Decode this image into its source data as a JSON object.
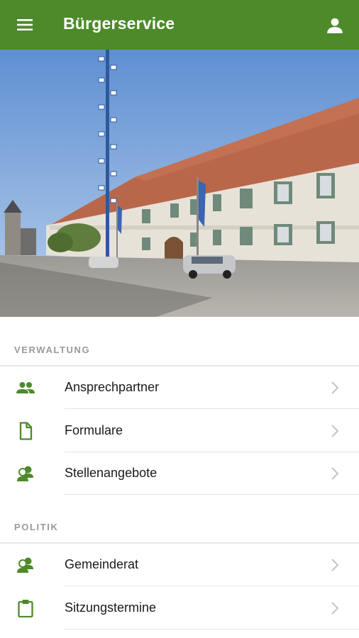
{
  "app_bar": {
    "title": "Bürgerservice",
    "menu_icon": "hamburger-menu-icon",
    "profile_icon": "person-icon",
    "background_color": "#4d8a2a"
  },
  "hero": {
    "image": "town-hall-square-photo"
  },
  "sections": [
    {
      "title": "VERWALTUNG",
      "items": [
        {
          "label": "Ansprechpartner",
          "icon": "people-icon"
        },
        {
          "label": "Formulare",
          "icon": "document-icon"
        },
        {
          "label": "Stellenangebote",
          "icon": "job-offers-icon"
        }
      ]
    },
    {
      "title": "POLITIK",
      "items": [
        {
          "label": "Gemeinderat",
          "icon": "council-icon"
        },
        {
          "label": "Sitzungstermine",
          "icon": "clipboard-icon"
        }
      ]
    }
  ],
  "accent_color": "#4d8a2a"
}
